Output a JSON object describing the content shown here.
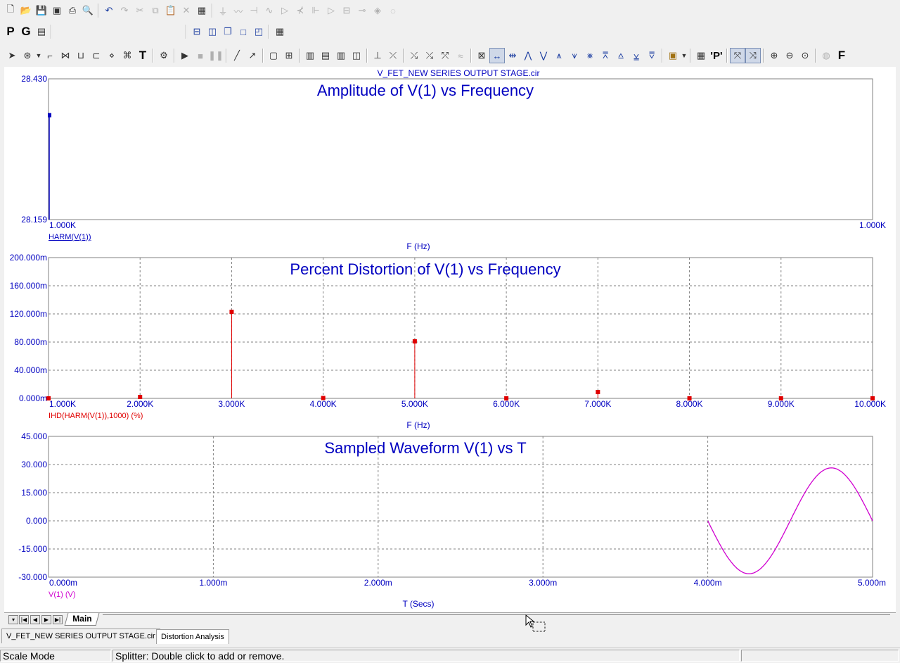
{
  "window_title": "V_FET_NEW SERIES OUTPUT STAGE.cir",
  "toolbar": {
    "mode_p": "P",
    "mode_g": "G",
    "text_tool": "T",
    "probe_tool": "'P'",
    "font_tool": "F"
  },
  "chart_data": [
    {
      "type": "line",
      "title": "Amplitude of V(1) vs Frequency",
      "xlabel": "F (Hz)",
      "trace_label": "HARM(V(1))",
      "x_ticks": [
        "1.000K",
        "1.000K"
      ],
      "y_ticks": [
        "28.430",
        "28.159"
      ],
      "ylim": [
        28.159,
        28.43
      ],
      "grid": false,
      "color": "#0000c0",
      "points": [
        {
          "x": 1000,
          "y": 28.159
        },
        {
          "x": 1000,
          "y": 28.36
        }
      ]
    },
    {
      "type": "bar",
      "title": "Percent Distortion of V(1) vs Frequency",
      "xlabel": "F (Hz)",
      "trace_label": "IHD(HARM(V(1)),1000) (%)",
      "x_ticks": [
        "1.000K",
        "2.000K",
        "3.000K",
        "4.000K",
        "5.000K",
        "6.000K",
        "7.000K",
        "8.000K",
        "9.000K",
        "10.000K"
      ],
      "y_ticks": [
        "200.000m",
        "160.000m",
        "120.000m",
        "80.000m",
        "40.000m",
        "0.000m"
      ],
      "xlim": [
        1000,
        10000
      ],
      "ylim": [
        0,
        0.2
      ],
      "grid": true,
      "color": "#e00000",
      "x": [
        1000,
        2000,
        3000,
        4000,
        5000,
        6000,
        7000,
        8000,
        9000,
        10000
      ],
      "values": [
        0,
        0.002,
        0.123,
        0.0005,
        0.081,
        0,
        0.009,
        0,
        0,
        0
      ]
    },
    {
      "type": "line",
      "title": "Sampled Waveform  V(1) vs T",
      "xlabel": "T (Secs)",
      "trace_label": "V(1) (V)",
      "x_ticks": [
        "0.000m",
        "1.000m",
        "2.000m",
        "3.000m",
        "4.000m",
        "5.000m"
      ],
      "y_ticks": [
        "45.000",
        "30.000",
        "15.000",
        "0.000",
        "-15.000",
        "-30.000"
      ],
      "xlim": [
        0,
        0.005
      ],
      "ylim": [
        -30,
        45
      ],
      "grid": true,
      "color": "#d000d0",
      "waveform": {
        "t_start": 0.004,
        "t_end": 0.005,
        "amplitude": 28.2,
        "frequency": 1000,
        "phase": "inverted-sine"
      }
    }
  ],
  "tabs": {
    "sheet_tab": "Main"
  },
  "doc_tabs": [
    "V_FET_NEW SERIES OUTPUT STAGE.cir",
    "Distortion Analysis"
  ],
  "status": {
    "mode": "Scale Mode",
    "message": "Splitter: Double click to add or remove."
  },
  "colors": {
    "axis_text": "#0000c0",
    "grid": "#808080"
  }
}
